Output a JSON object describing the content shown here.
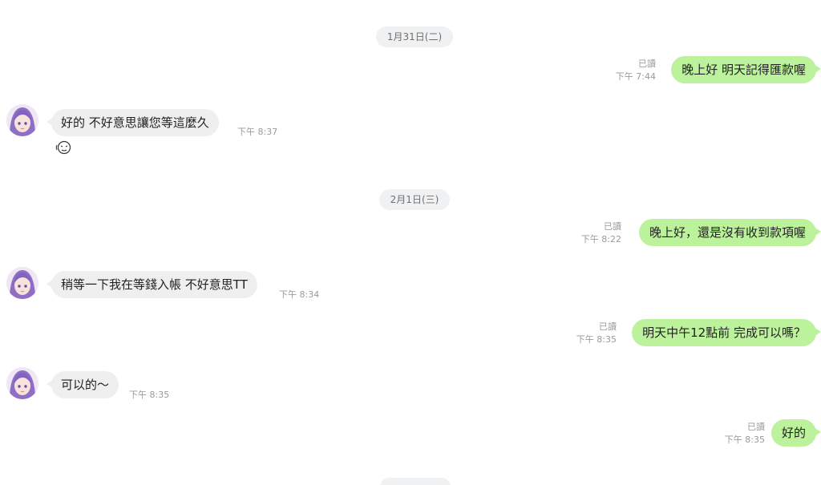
{
  "colors": {
    "incoming_bubble": "#efefef",
    "outgoing_bubble": "#bdf29c",
    "date_pill": "#f0f1f2",
    "meta_text": "#9a9a9a"
  },
  "dates": {
    "d1": "1月31日(二)",
    "d2": "2月1日(三)"
  },
  "messages": {
    "m1": {
      "text": "晚上好 明天記得匯款喔",
      "read": "已讀",
      "time": "下午 7:44"
    },
    "m2": {
      "text": "好的 不好意思讓您等這麼久",
      "time": "下午 8:37",
      "sticker": "embarrassed-face-emoji"
    },
    "m3": {
      "text": "晚上好，還是沒有收到款項喔",
      "read": "已讀",
      "time": "下午 8:22"
    },
    "m4": {
      "text": "稍等一下我在等錢入帳 不好意思TT",
      "time": "下午 8:34"
    },
    "m5": {
      "text": "明天中午12點前 完成可以嗎？",
      "read": "已讀",
      "time": "下午 8:35"
    },
    "m6": {
      "text": "可以的～",
      "time": "下午 8:35"
    },
    "m7": {
      "text": "好的",
      "read": "已讀",
      "time": "下午 8:35"
    }
  }
}
